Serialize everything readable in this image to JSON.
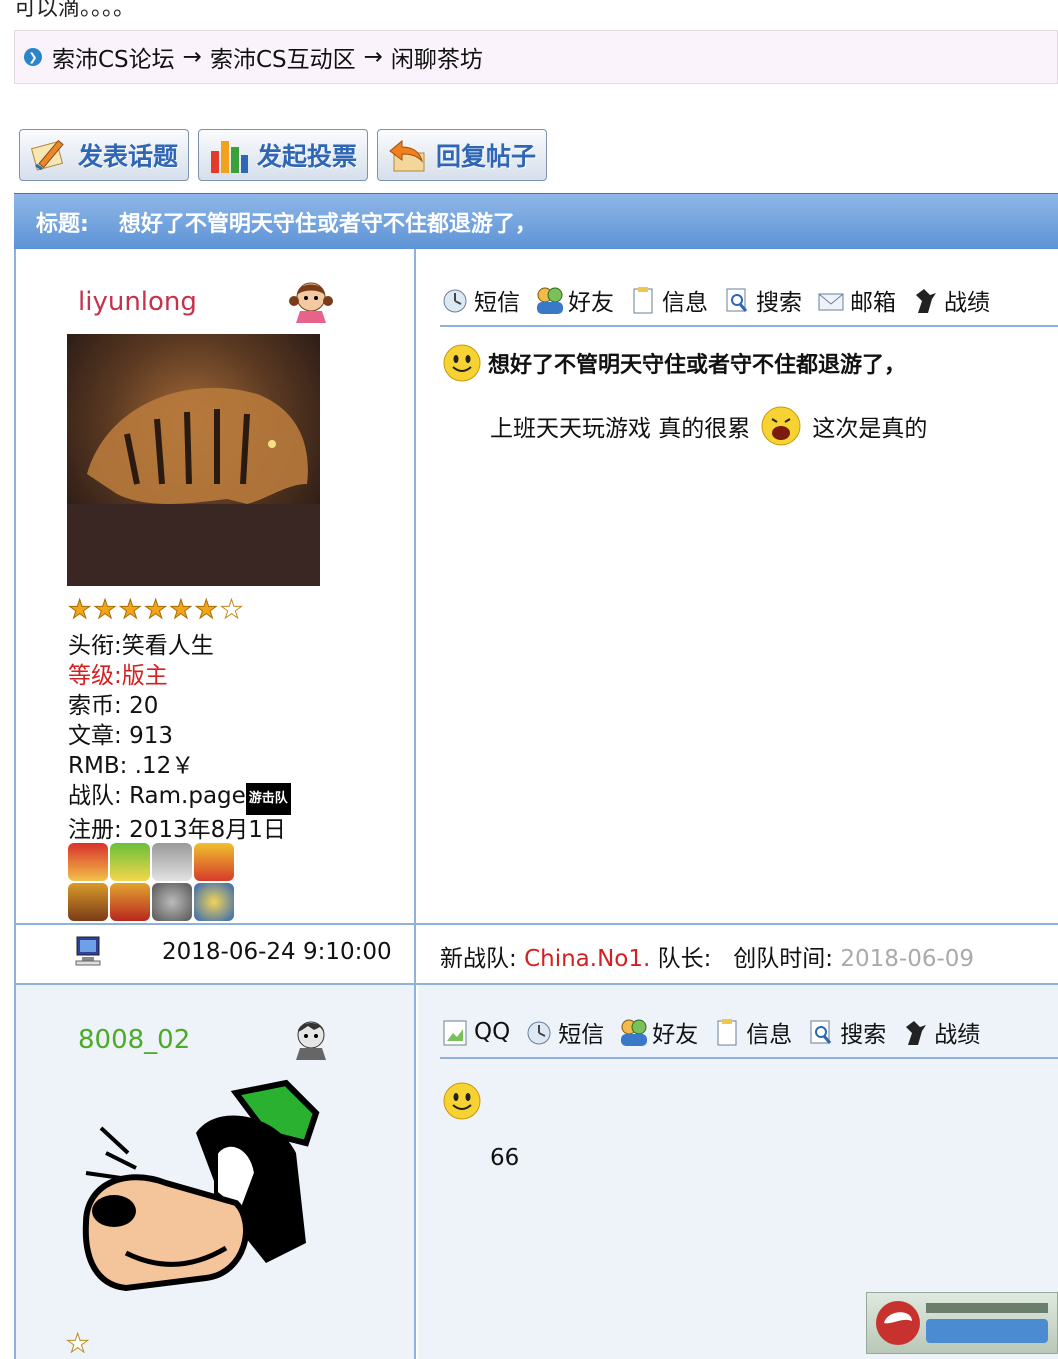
{
  "top_text": "可以滴。。。。",
  "breadcrumb": {
    "items": [
      "索沛CS论坛",
      "索沛CS互动区",
      "闲聊茶坊"
    ],
    "separator": "→"
  },
  "buttons": {
    "new_topic": "发表话题",
    "new_poll": "发起投票",
    "reply": "回复帖子"
  },
  "thread": {
    "title_label": "标题:",
    "title": "想好了不管明天守住或者守不住都退游了，"
  },
  "post1": {
    "username": "liyunlong",
    "stars_on": 6,
    "stars_total": 7,
    "info": {
      "title_label": "头衔:",
      "title_value": "笑看人生",
      "level_label": "等级:",
      "level_value": "版主",
      "coins_label": "索币:",
      "coins_value": "20",
      "posts_label": "文章:",
      "posts_value": "913",
      "rmb_label": "RMB:",
      "rmb_value": ".12￥",
      "team_label": "战队:",
      "team_value": "Ram.page",
      "team_badge": "游击队",
      "reg_label": "注册:",
      "reg_value": "2013年8月1日"
    },
    "toolbar": [
      "短信",
      "好友",
      "信息",
      "搜索",
      "邮箱",
      "战绩"
    ],
    "post_title": "想好了不管明天守住或者守不住都退游了，",
    "body_part1": "上班天天玩游戏  真的很累",
    "body_part2": "这次是真的",
    "datetime": "2018-06-24 9:10:00",
    "team_meta": {
      "new_team_label": "新战队:",
      "team": "China.No1.",
      "captain_label": "队长:",
      "created_label": "创队时间:",
      "created": "2018-06-09"
    }
  },
  "post2": {
    "username": "8008_02",
    "toolbar": [
      "QQ",
      "短信",
      "好友",
      "信息",
      "搜索",
      "战绩"
    ],
    "body": "66"
  },
  "colors": {
    "title_bar": "#6d9fdc",
    "border": "#8fb2dc",
    "username_red": "#c8314b",
    "username_green": "#4bab29"
  }
}
